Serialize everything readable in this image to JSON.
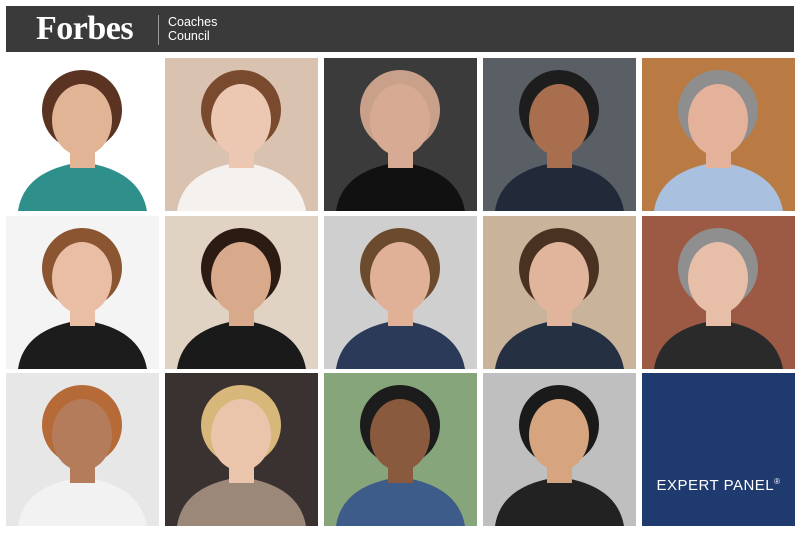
{
  "header": {
    "logo": "Forbes",
    "council_line1": "Coaches",
    "council_line2": "Council"
  },
  "expert_panel": {
    "label": "EXPERT PANEL",
    "mark": "®"
  },
  "portraits": [
    {
      "bg": "#ffffff",
      "skin": "#e2b496",
      "hair": "#5a3322",
      "shirt": "#2f8f8a"
    },
    {
      "bg": "#d9c3b0",
      "skin": "#ecc7b2",
      "hair": "#7a4a2e",
      "shirt": "#f4f1ee"
    },
    {
      "bg": "#3b3b3b",
      "skin": "#d7ab93",
      "hair": "#c9a08a",
      "shirt": "#111111"
    },
    {
      "bg": "#5a5f66",
      "skin": "#a86e4e",
      "hair": "#1d1d1d",
      "shirt": "#222a3a"
    },
    {
      "bg": "#b97a44",
      "skin": "#e4b29a",
      "hair": "#8e8e8e",
      "shirt": "#a9c1de"
    },
    {
      "bg": "#f4f4f4",
      "skin": "#e9bea4",
      "hair": "#8a5530",
      "shirt": "#1c1c1c"
    },
    {
      "bg": "#e1d3c3",
      "skin": "#d9a98b",
      "hair": "#2b1b13",
      "shirt": "#1a1a1a"
    },
    {
      "bg": "#cfcfcf",
      "skin": "#e0b196",
      "hair": "#6b4a2e",
      "shirt": "#2a3a58"
    },
    {
      "bg": "#c9b39a",
      "skin": "#e1b59c",
      "hair": "#4a3222",
      "shirt": "#263043"
    },
    {
      "bg": "#9c5a44",
      "skin": "#e7bea8",
      "hair": "#8f8f8f",
      "shirt": "#2a2a2a"
    },
    {
      "bg": "#e7e7e7",
      "skin": "#b47c5a",
      "hair": "#b56a38",
      "shirt": "#f2f2f2"
    },
    {
      "bg": "#3a3230",
      "skin": "#eac4ab",
      "hair": "#d8b77a",
      "shirt": "#9b8878"
    },
    {
      "bg": "#86a57a",
      "skin": "#8a5a3e",
      "hair": "#1c1c1c",
      "shirt": "#3e5c8a"
    },
    {
      "bg": "#bfbfbf",
      "skin": "#d6a57f",
      "hair": "#1a1a1a",
      "shirt": "#222222"
    }
  ]
}
